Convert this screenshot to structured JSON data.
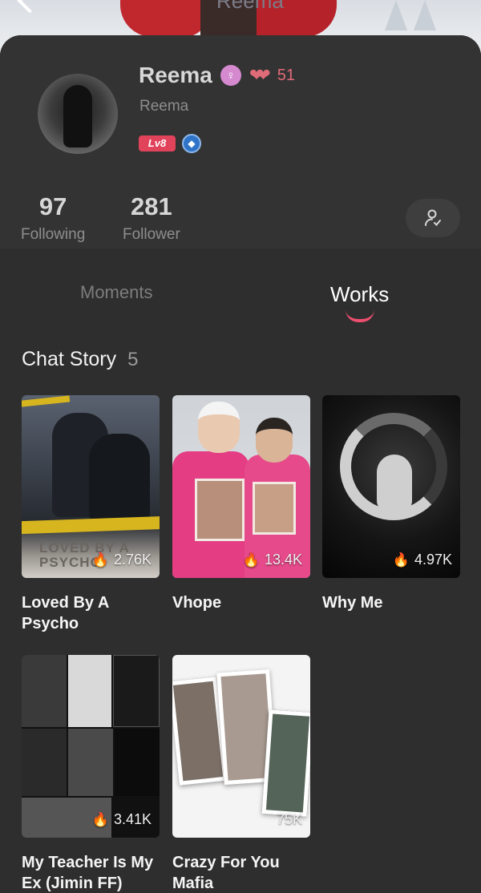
{
  "banner": {
    "name": "Reema"
  },
  "profile": {
    "name": "Reema",
    "username": "Reema",
    "hearts_count": "51",
    "level": "Lv8"
  },
  "stats": {
    "following": {
      "value": "97",
      "label": "Following"
    },
    "follower": {
      "value": "281",
      "label": "Follower"
    }
  },
  "tabs": [
    {
      "label": "Moments",
      "active": false
    },
    {
      "label": "Works",
      "active": true
    }
  ],
  "section": {
    "title": "Chat Story",
    "count": "5"
  },
  "stories": [
    {
      "title": "Loved By A Psycho",
      "views": "2.76K",
      "cover_text": "LOVED BY A PSYCHO"
    },
    {
      "title": "Vhope",
      "views": "13.4K"
    },
    {
      "title": "Why Me",
      "views": "4.97K"
    },
    {
      "title": "My Teacher Is My Ex (Jimin FF)",
      "views": "3.41K"
    },
    {
      "title": "Crazy For You Mafia",
      "views": "75K"
    }
  ],
  "colors": {
    "accent": "#ee4f70",
    "level_badge": "#e0435a",
    "hearts": "#e06b79"
  }
}
